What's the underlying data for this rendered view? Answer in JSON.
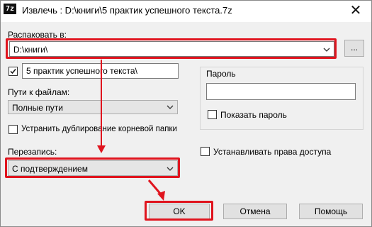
{
  "window": {
    "icon_text": "7z",
    "title": "Извлечь : D:\\книги\\5 практик успешного текста.7z",
    "close_symbol": "✕"
  },
  "extract": {
    "label": "Распаковать в:",
    "path": "D:\\книги\\",
    "browse_label": "..."
  },
  "subfolder": {
    "checked": true,
    "value": "5 практик успешного текста\\"
  },
  "paths": {
    "label": "Пути к файлам:",
    "selected": "Полные пути"
  },
  "eliminate_duplicates": {
    "checked": false,
    "label": "Устранить дублирование корневой папки"
  },
  "overwrite": {
    "label": "Перезапись:",
    "selected": "С подтверждением"
  },
  "password": {
    "label": "Пароль",
    "value": "",
    "show_label": "Показать пароль",
    "show_checked": false
  },
  "access_rights": {
    "checked": false,
    "label": "Устанавливать права доступа"
  },
  "buttons": {
    "ok": "OK",
    "cancel": "Отмена",
    "help": "Помощь"
  },
  "colors": {
    "highlight": "#e0141e"
  }
}
